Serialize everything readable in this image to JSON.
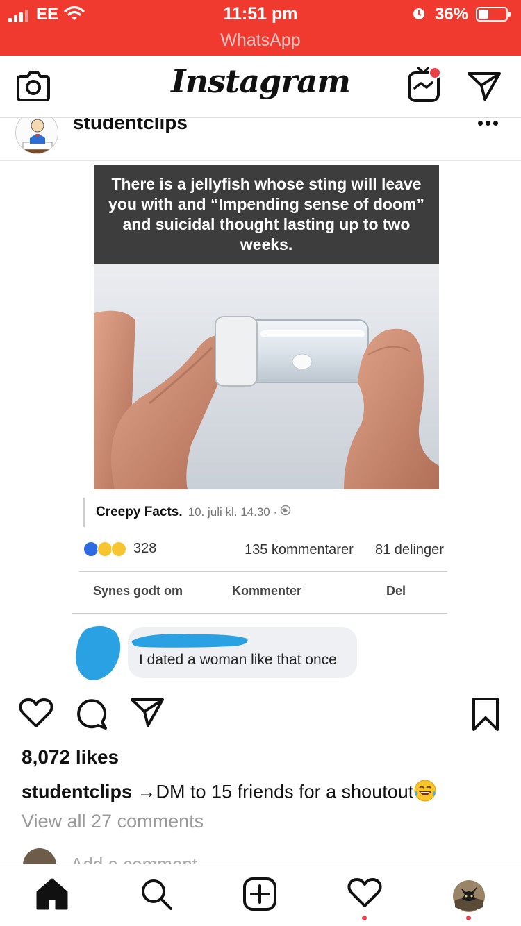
{
  "status_bar": {
    "carrier": "EE",
    "time": "11:51 pm",
    "return_app": "WhatsApp",
    "battery_percent": "36%",
    "battery_level": 0.36,
    "background_color": "#f13a2f"
  },
  "header": {
    "logo_text": "Instagram",
    "icons": [
      "camera-icon",
      "igtv-icon",
      "direct-message-icon"
    ],
    "igtv_badge_color": "#e8414a"
  },
  "post": {
    "username": "studentclips",
    "more_icon": "more-options-icon",
    "image": {
      "caption_text": "There is a jellyfish whose sting will leave you with and “Impending sense of doom” and suicidal thought lasting up to two weeks.",
      "facebook": {
        "page_name": "Creepy Facts.",
        "date": "10. juli kl. 14.30 ·",
        "reaction_count": "328",
        "comments": "135 kommentarer",
        "shares": "81 delinger",
        "actions": [
          "Synes godt om",
          "Kommenter",
          "Del"
        ],
        "comment_text": "I dated a woman like that once"
      }
    },
    "action_icons": [
      "heart-icon",
      "comment-icon",
      "share-icon",
      "bookmark-icon"
    ],
    "likes": "8,072 likes",
    "caption_user": "studentclips",
    "caption_text": "→DM to 15 friends for a shoutout",
    "view_comments": "View all 27 comments",
    "add_comment_placeholder": "Add a comment..."
  },
  "bottom_nav": {
    "items": [
      "home-icon",
      "search-icon",
      "new-post-icon",
      "activity-icon",
      "profile-avatar"
    ],
    "notification_dot_color": "#e8414a"
  }
}
